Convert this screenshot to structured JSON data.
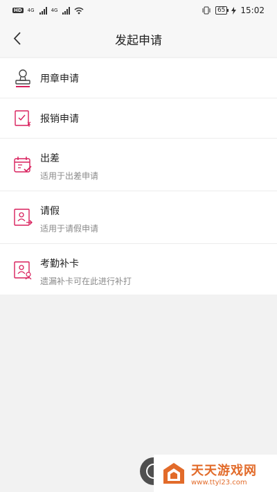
{
  "status_bar": {
    "left_tag": "HD",
    "net1": "4G",
    "net2": "4G",
    "battery": "65",
    "time": "15:02"
  },
  "nav": {
    "title": "发起申请"
  },
  "items": [
    {
      "title": "用章申请",
      "subtitle": "",
      "icon": "stamp-icon"
    },
    {
      "title": "报销申请",
      "subtitle": "",
      "icon": "reimburse-icon"
    },
    {
      "title": "出差",
      "subtitle": "适用于出差申请",
      "icon": "calendar-icon"
    },
    {
      "title": "请假",
      "subtitle": "适用于请假申请",
      "icon": "leave-icon"
    },
    {
      "title": "考勤补卡",
      "subtitle": "遗漏补卡可在此进行补打",
      "icon": "attendance-icon"
    }
  ],
  "watermark": {
    "name": "天天游戏网",
    "url": "www.ttyl23.com"
  },
  "colors": {
    "accent": "#d81e5b",
    "stamp": "#444444",
    "watermark": "#e26b2a"
  }
}
